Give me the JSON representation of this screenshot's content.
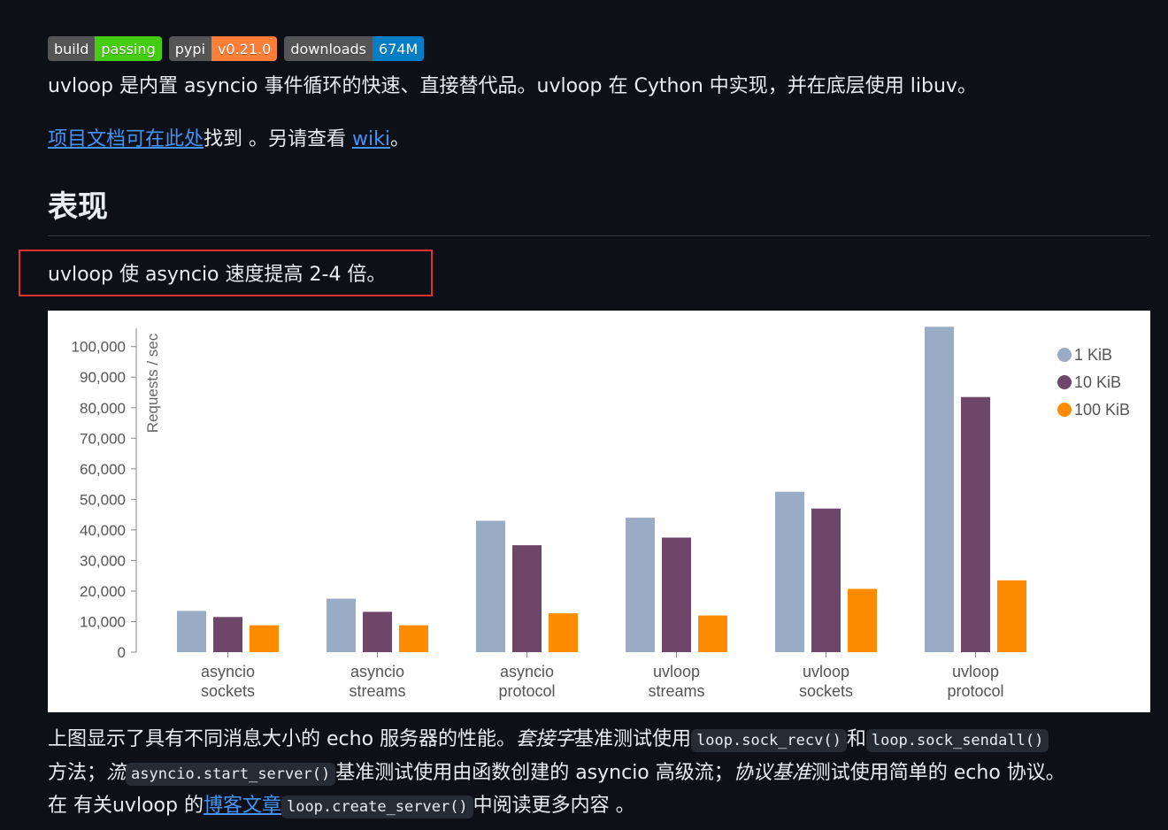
{
  "badges": [
    {
      "label": "build",
      "value": "passing",
      "color": "#44cc11"
    },
    {
      "label": "pypi",
      "value": "v0.21.0",
      "color": "#fe7d37"
    },
    {
      "label": "downloads",
      "value": "674M",
      "color": "#007ec6"
    }
  ],
  "intro": "uvloop 是内置 asyncio 事件循环的快速、直接替代品。uvloop 在 Cython 中实现，并在底层使用 libuv。",
  "docs": {
    "link_text": "项目文档可在此处",
    "mid_text": "找到 。另请查看 ",
    "wiki_text": "wiki",
    "end_text": "。"
  },
  "section_title": "表现",
  "highlight_text": "uvloop 使 asyncio 速度提高 2-4 倍。",
  "chart_data": {
    "type": "bar",
    "ylabel": "Requests / sec",
    "ylim": [
      0,
      106000
    ],
    "yticks": [
      0,
      10000,
      20000,
      30000,
      40000,
      50000,
      60000,
      70000,
      80000,
      90000,
      100000
    ],
    "ytick_labels": [
      "0",
      "10,000",
      "20,000",
      "30,000",
      "40,000",
      "50,000",
      "60,000",
      "70,000",
      "80,000",
      "90,000",
      "100,000"
    ],
    "categories": [
      [
        "asyncio",
        "sockets"
      ],
      [
        "asyncio",
        "streams"
      ],
      [
        "asyncio",
        "protocol"
      ],
      [
        "uvloop",
        "streams"
      ],
      [
        "uvloop",
        "sockets"
      ],
      [
        "uvloop",
        "protocol"
      ]
    ],
    "series": [
      {
        "name": "1 KiB",
        "color": "#9aabc5",
        "values": [
          13500,
          17500,
          43000,
          44000,
          52500,
          106500
        ]
      },
      {
        "name": "10 KiB",
        "color": "#6e4669",
        "values": [
          11500,
          13200,
          35000,
          37500,
          47000,
          83500
        ]
      },
      {
        "name": "100 KiB",
        "color": "#ff8c00",
        "values": [
          8800,
          8800,
          12700,
          12000,
          20700,
          23500
        ]
      }
    ],
    "legend_position": "top-right",
    "grid": false
  },
  "description": {
    "p1": "上图显示了具有不同消息大小的 echo 服务器的性能。",
    "sockets_em": "套接字",
    "p2": "基准测试使用",
    "code1": "loop.sock_recv()",
    "and": "和",
    "code2": "loop.sock_sendall()",
    "p3": "方法；",
    "streams_em": "流",
    "code3": "asyncio.start_server()",
    "p4": "基准测试使用由函数创建的 asyncio 高级流；",
    "protocol_em": "协议基准",
    "p5": "测试使用简单的 echo 协议。在 有关uvloop 的",
    "blog_link": "博客文章",
    "code4": "loop.create_server()",
    "p6": "中阅读更多内容 。"
  }
}
